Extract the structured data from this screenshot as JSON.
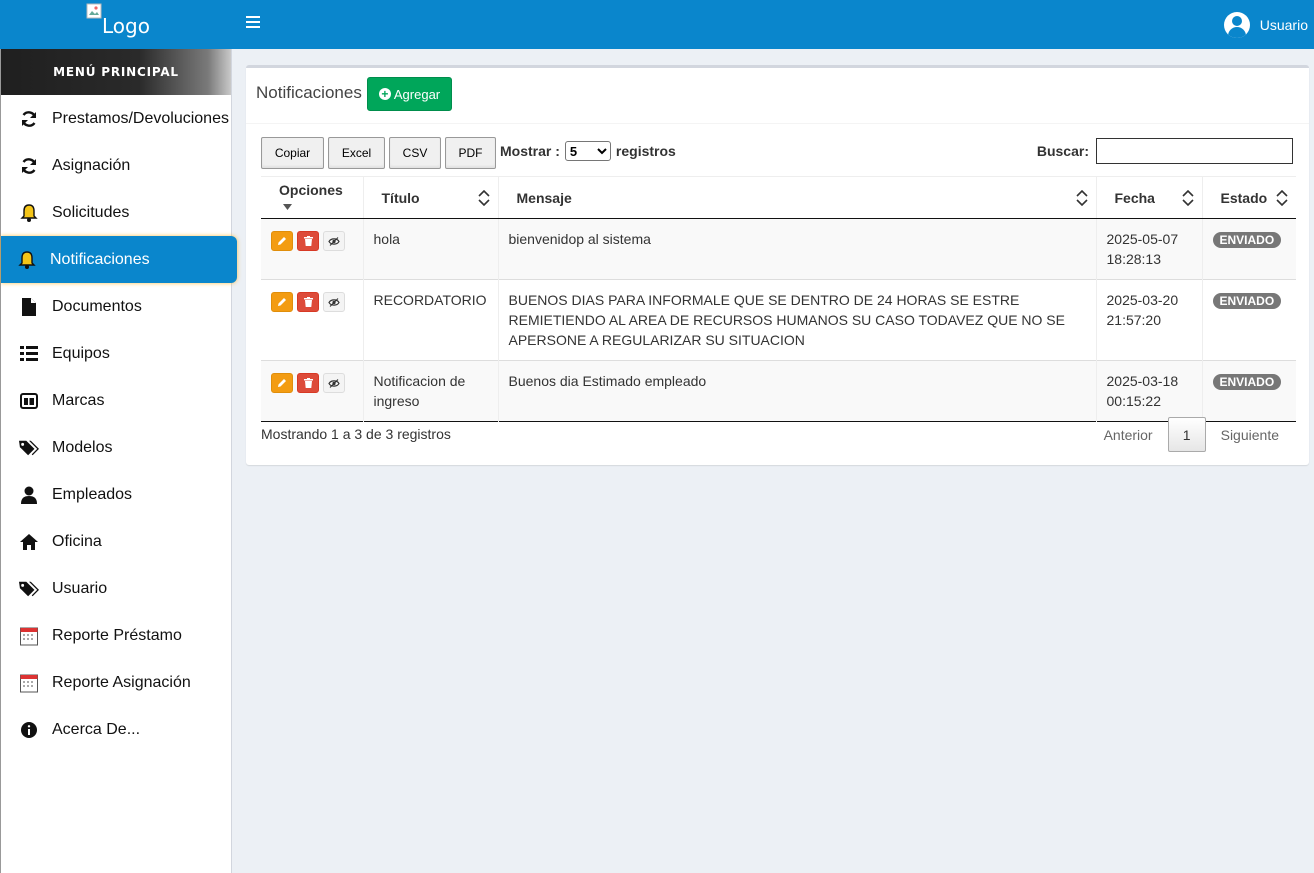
{
  "header": {
    "logo_alt": "Logo",
    "user_name": "Usuario"
  },
  "sidebar": {
    "title": "MENÚ PRINCIPAL",
    "items": [
      {
        "label": "Prestamos/Devoluciones",
        "icon": "refresh-icon"
      },
      {
        "label": "Asignación",
        "icon": "refresh-icon"
      },
      {
        "label": "Solicitudes",
        "icon": "bell-icon"
      },
      {
        "label": "Notificaciones",
        "icon": "bell-icon",
        "active": true
      },
      {
        "label": "Documentos",
        "icon": "file-icon"
      },
      {
        "label": "Equipos",
        "icon": "list-icon"
      },
      {
        "label": "Marcas",
        "icon": "calendar-box-icon"
      },
      {
        "label": "Modelos",
        "icon": "tags-icon"
      },
      {
        "label": "Empleados",
        "icon": "user-icon"
      },
      {
        "label": "Oficina",
        "icon": "home-icon"
      },
      {
        "label": "Usuario",
        "icon": "tags-icon"
      },
      {
        "label": "Reporte Préstamo",
        "icon": "calendar-icon"
      },
      {
        "label": "Reporte Asignación",
        "icon": "calendar-icon"
      },
      {
        "label": "Acerca De...",
        "icon": "info-icon"
      }
    ]
  },
  "main": {
    "title": "Notificaciones",
    "add_label": "Agregar",
    "export_buttons": [
      "Copiar",
      "Excel",
      "CSV",
      "PDF"
    ],
    "show_prefix": "Mostrar :",
    "show_value": "5",
    "show_suffix": "registros",
    "search_label": "Buscar:",
    "search_value": "",
    "columns": [
      "Opciones",
      "Título",
      "Mensaje",
      "Fecha",
      "Estado"
    ],
    "rows": [
      {
        "titulo": "hola",
        "mensaje": "bienvenidop al sistema",
        "fecha": "2025-05-07 18:28:13",
        "estado": "ENVIADO"
      },
      {
        "titulo": "RECORDATORIO",
        "mensaje": "BUENOS DIAS PARA INFORMALE QUE SE DENTRO DE 24 HORAS SE ESTRE REMIETIENDO AL AREA DE RECURSOS HUMANOS SU CASO TODAVEZ QUE NO SE APERSONE A REGULARIZAR SU SITUACION",
        "fecha": "2025-03-20 21:57:20",
        "estado": "ENVIADO"
      },
      {
        "titulo": "Notificacion de ingreso",
        "mensaje": "Buenos dia Estimado empleado",
        "fecha": "2025-03-18 00:15:22",
        "estado": "ENVIADO"
      }
    ],
    "info": "Mostrando 1 a 3 de 3 registros",
    "pager": {
      "prev": "Anterior",
      "current": "1",
      "next": "Siguiente"
    }
  },
  "colors": {
    "primary": "#0a86cc",
    "success": "#00a65a",
    "warning": "#f39c12",
    "danger": "#dd4b39",
    "badge": "#777777"
  }
}
